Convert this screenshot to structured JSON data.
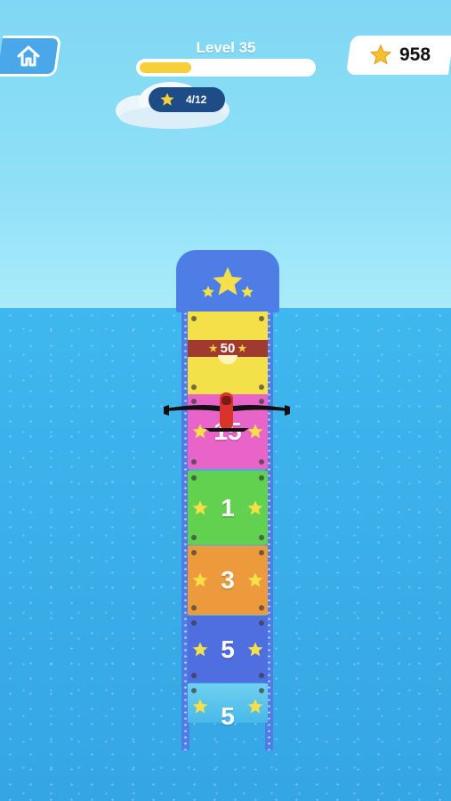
{
  "hud": {
    "level_label": "Level 35",
    "level_progress": 0.3,
    "stars_collected": "4/12",
    "coins": "958"
  },
  "tower": {
    "band_value": "50",
    "panels": [
      {
        "value": "",
        "color": "#f4e14a"
      },
      {
        "value": "",
        "color": "#f4e14a"
      },
      {
        "value": "15",
        "color": "#e864c9"
      },
      {
        "value": "1",
        "color": "#62d14f"
      },
      {
        "value": "3",
        "color": "#ec9a3c"
      },
      {
        "value": "5",
        "color": "#4f6fe0"
      },
      {
        "value": "5",
        "color": "#6fd0f0"
      }
    ]
  },
  "colors": {
    "sky": "#8fe0f7",
    "sea": "#3aaee9",
    "tower": "#4f7de6",
    "star": "#f6cf3b",
    "plane": "#d8342a"
  },
  "icons": {
    "home": "home-icon",
    "star": "star-icon",
    "plane": "plane-icon"
  }
}
